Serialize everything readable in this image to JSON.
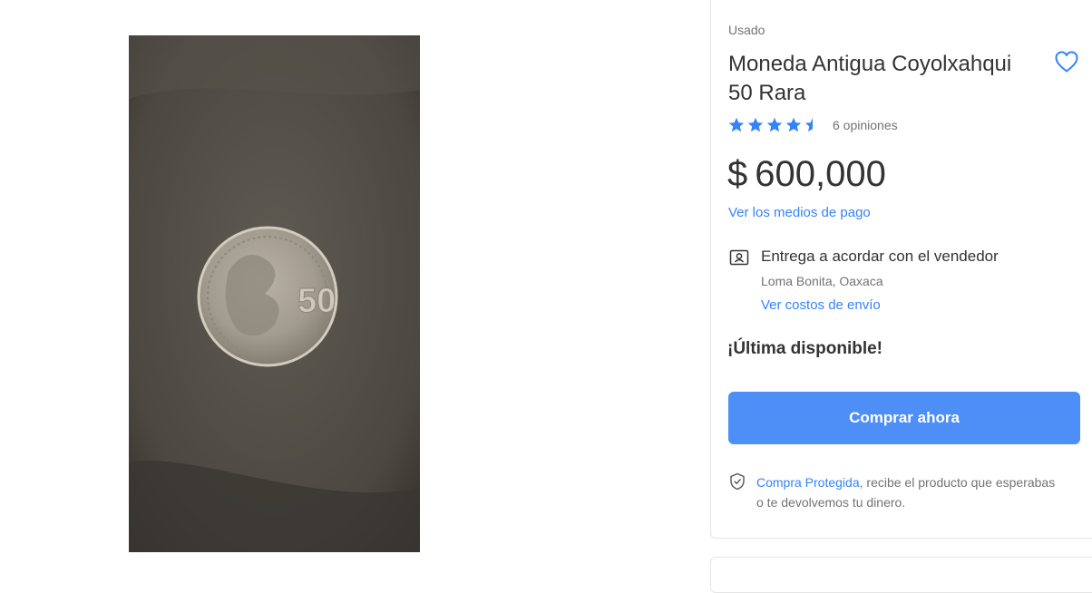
{
  "gallery": {
    "image_alt": "Moneda Coyolxahqui 50",
    "coin_text": "50"
  },
  "product": {
    "condition": "Usado",
    "title": "Moneda Antigua Coyolxahqui 50 Rara",
    "rating": {
      "value": 4.5,
      "max": 5,
      "reviews_label": "6 opiniones"
    },
    "price": {
      "currency": "$",
      "amount": "600,000"
    },
    "payment_link": "Ver los medios de pago",
    "shipping": {
      "title": "Entrega a acordar con el vendedor",
      "location": "Loma Bonita, Oaxaca",
      "costs_link": "Ver costos de envío"
    },
    "stock": "¡Última disponible!",
    "buy_button": "Comprar ahora",
    "protection": {
      "link": "Compra Protegida",
      "text": ", recibe el producto que esperabas o te devolvemos tu dinero."
    }
  },
  "colors": {
    "accent": "#3483fa",
    "button": "#4d8ef7",
    "star": "#3483fa"
  },
  "icons": [
    "heart-icon",
    "star-icon",
    "delivery-icon",
    "shield-check-icon"
  ]
}
